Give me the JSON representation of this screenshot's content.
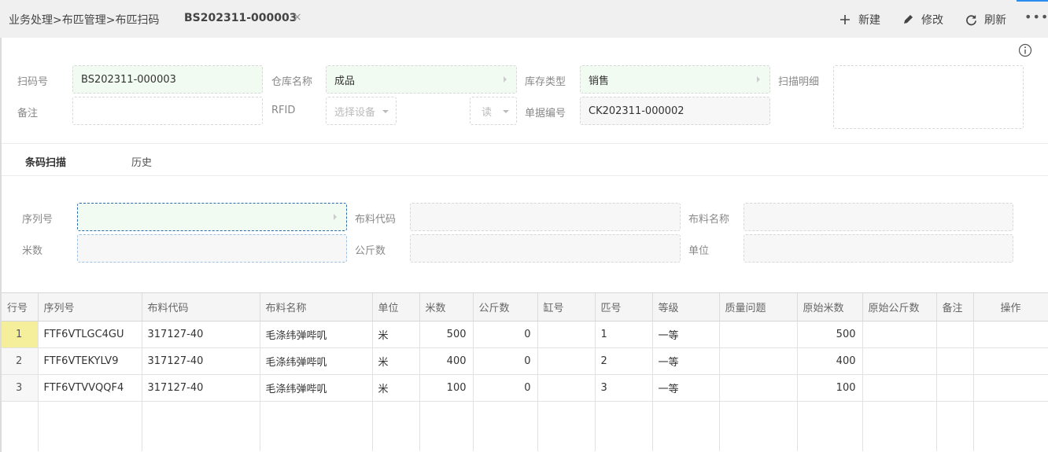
{
  "topbar": {
    "breadcrumb": "业务处理>布匹管理>布匹扫码",
    "doc_title": "BS202311-000003",
    "close_symbol": "×",
    "actions": {
      "new": "新建",
      "edit": "修改",
      "refresh": "刷新"
    },
    "more_symbol": "•••"
  },
  "form": {
    "scan_no": {
      "label": "扫码号",
      "value": "BS202311-000003"
    },
    "warehouse": {
      "label": "仓库名称",
      "value": "成品"
    },
    "stock_type": {
      "label": "库存类型",
      "value": "销售"
    },
    "scan_detail": {
      "label": "扫描明细",
      "value": ""
    },
    "remark": {
      "label": "备注",
      "value": ""
    },
    "rfid": {
      "label": "RFID",
      "device_placeholder": "选择设备",
      "mode_value": "读"
    },
    "doc_no": {
      "label": "单据编号",
      "value": "CK202311-000002"
    }
  },
  "tabs": {
    "barcode_scan": "条码扫描",
    "history": "历史"
  },
  "scan": {
    "serial": {
      "label": "序列号",
      "value": ""
    },
    "fabric_code": {
      "label": "布料代码",
      "value": ""
    },
    "fabric_name": {
      "label": "布料名称",
      "value": ""
    },
    "meters": {
      "label": "米数",
      "value": ""
    },
    "kg": {
      "label": "公斤数",
      "value": ""
    },
    "unit": {
      "label": "单位",
      "value": ""
    }
  },
  "table": {
    "headers": [
      "行号",
      "序列号",
      "布料代码",
      "布料名称",
      "单位",
      "米数",
      "公斤数",
      "缸号",
      "匹号",
      "等级",
      "质量问题",
      "原始米数",
      "原始公斤数",
      "备注",
      "操作"
    ],
    "rows": [
      [
        "1",
        "FTF6VTLGC4GU",
        "317127-40",
        "毛涤纬弹哔叽",
        "米",
        "500",
        "0",
        "",
        "1",
        "一等",
        "",
        "500",
        "",
        "",
        ""
      ],
      [
        "2",
        "FTF6VTEKYLV9",
        "317127-40",
        "毛涤纬弹哔叽",
        "米",
        "400",
        "0",
        "",
        "2",
        "一等",
        "",
        "400",
        "",
        "",
        ""
      ],
      [
        "3",
        "FTF6VTVVQQF4",
        "317127-40",
        "毛涤纬弹哔叽",
        "米",
        "100",
        "0",
        "",
        "3",
        "一等",
        "",
        "100",
        "",
        "",
        ""
      ]
    ]
  },
  "colors": {
    "accent": "#2d8cf0",
    "selected_row": "#f5ef9c",
    "input_green": "#f2fbf2"
  }
}
